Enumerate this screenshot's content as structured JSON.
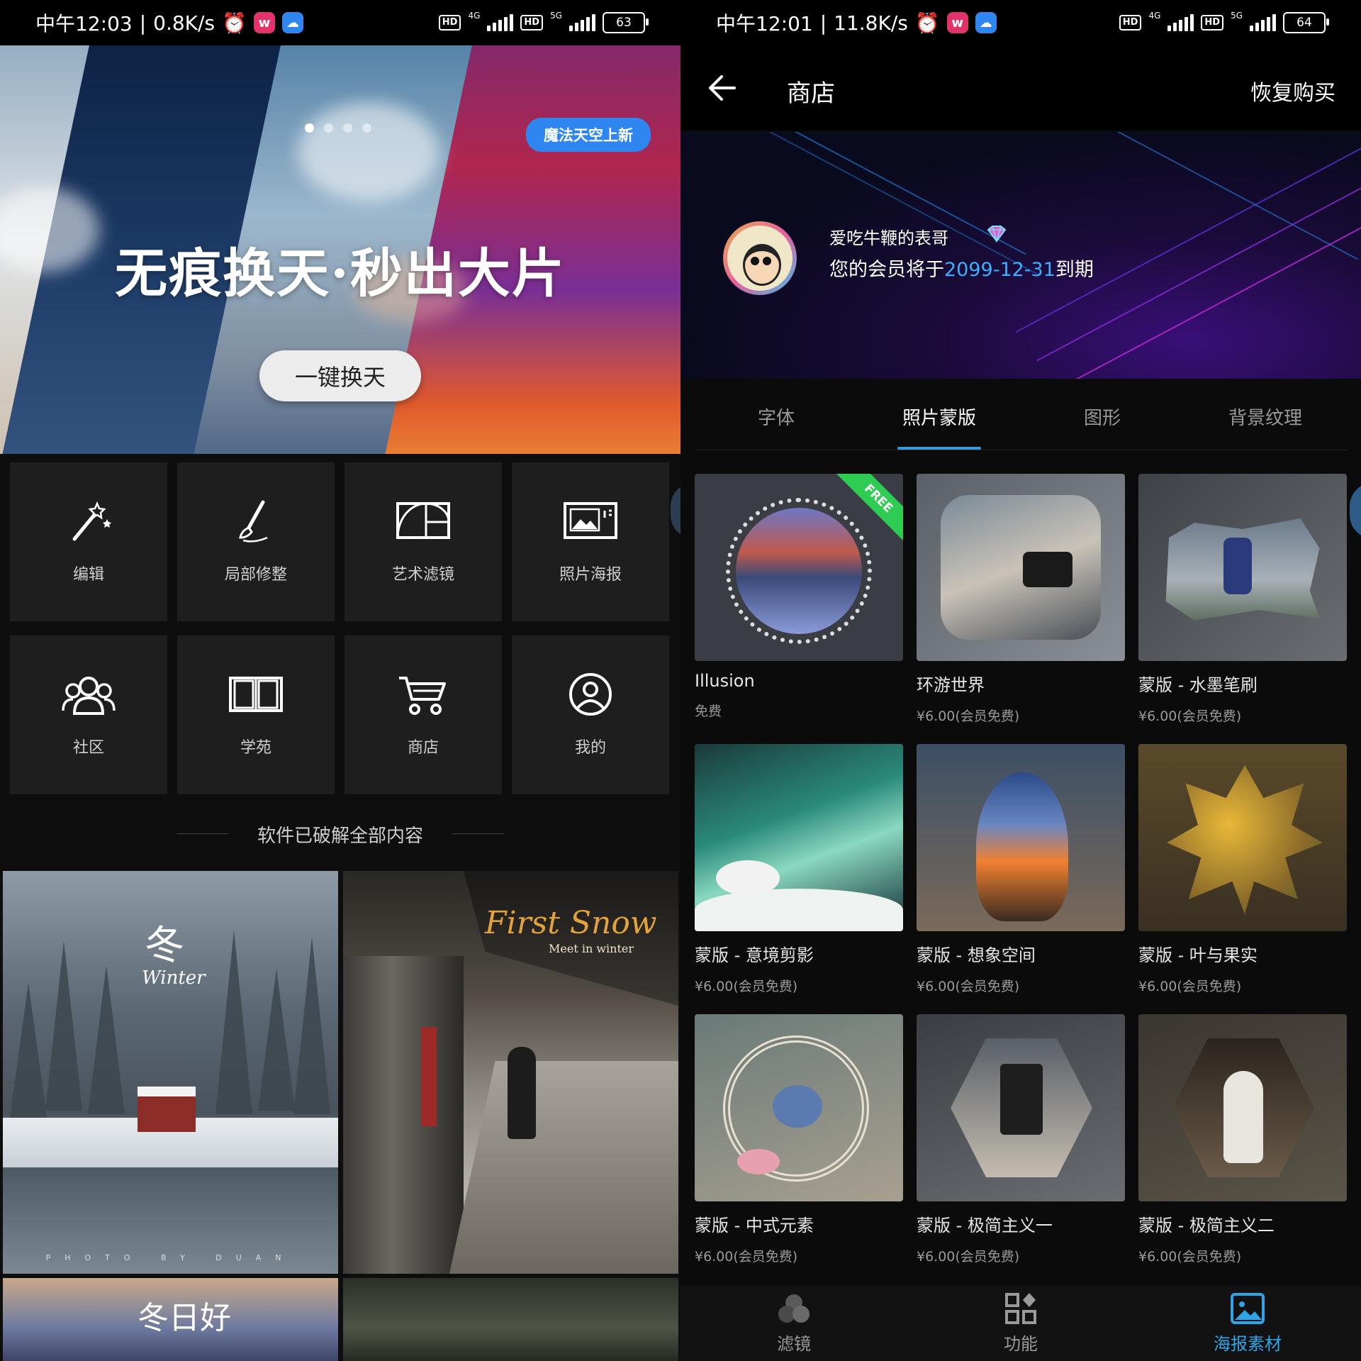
{
  "left": {
    "status": {
      "time": "中午12:03",
      "speed": "0.8K/s",
      "net1": "4G",
      "net2": "5G",
      "hd": "HD",
      "battery": "63"
    },
    "hero": {
      "headline": "无痕换天·秒出大片",
      "cta": "一键换天",
      "badge": "魔法天空上新",
      "page_count": 4,
      "active_page": 1
    },
    "tools": [
      {
        "label": "编辑",
        "icon": "magic-wand-icon"
      },
      {
        "label": "局部修整",
        "icon": "brush-icon"
      },
      {
        "label": "艺术滤镜",
        "icon": "golden-ratio-icon"
      },
      {
        "label": "照片海报",
        "icon": "poster-icon"
      },
      {
        "label": "社区",
        "icon": "community-icon"
      },
      {
        "label": "学苑",
        "icon": "book-icon"
      },
      {
        "label": "商店",
        "icon": "cart-icon"
      },
      {
        "label": "我的",
        "icon": "user-icon"
      }
    ],
    "divider": "软件已破解全部内容",
    "feed": [
      {
        "title": "冬",
        "subtitle": "Winter",
        "credit": "PHOTO BY DUAN"
      },
      {
        "title": "First Snow",
        "subtitle": "Meet in winter"
      },
      {
        "title": "冬日好"
      },
      {
        "title": ""
      }
    ]
  },
  "right": {
    "status": {
      "time": "中午12:01",
      "speed": "11.8K/s",
      "net1": "4G",
      "net2": "5G",
      "hd": "HD",
      "battery": "64"
    },
    "header": {
      "title": "商店",
      "restore": "恢复购买",
      "back_icon": "back-arrow-icon"
    },
    "profile": {
      "username": "爱吃牛鞭的表哥",
      "member_prefix": "您的会员将于",
      "member_date": "2099-12-31",
      "member_suffix": "到期",
      "badge_icon": "diamond-icon"
    },
    "tabs": [
      "字体",
      "照片蒙版",
      "图形",
      "背景纹理"
    ],
    "active_tab": 1,
    "items": [
      {
        "name": "Illusion",
        "price": "免费",
        "free_tag": "FREE"
      },
      {
        "name": "环游世界",
        "price": "¥6.00(会员免费)"
      },
      {
        "name": "蒙版 - 水墨笔刷",
        "price": "¥6.00(会员免费)"
      },
      {
        "name": "蒙版 - 意境剪影",
        "price": "¥6.00(会员免费)"
      },
      {
        "name": "蒙版 - 想象空间",
        "price": "¥6.00(会员免费)"
      },
      {
        "name": "蒙版 - 叶与果实",
        "price": "¥6.00(会员免费)"
      },
      {
        "name": "蒙版 - 中式元素",
        "price": "¥6.00(会员免费)"
      },
      {
        "name": "蒙版 - 极简主义一",
        "price": "¥6.00(会员免费)"
      },
      {
        "name": "蒙版 - 极简主义二",
        "price": "¥6.00(会员免费)"
      }
    ],
    "bottom_nav": [
      {
        "label": "滤镜",
        "icon": "filter-icon"
      },
      {
        "label": "功能",
        "icon": "apps-icon"
      },
      {
        "label": "海报素材",
        "icon": "poster-material-icon"
      }
    ],
    "active_nav": 2,
    "accent": "#2da5e8",
    "free_color": "#2ecc53"
  }
}
